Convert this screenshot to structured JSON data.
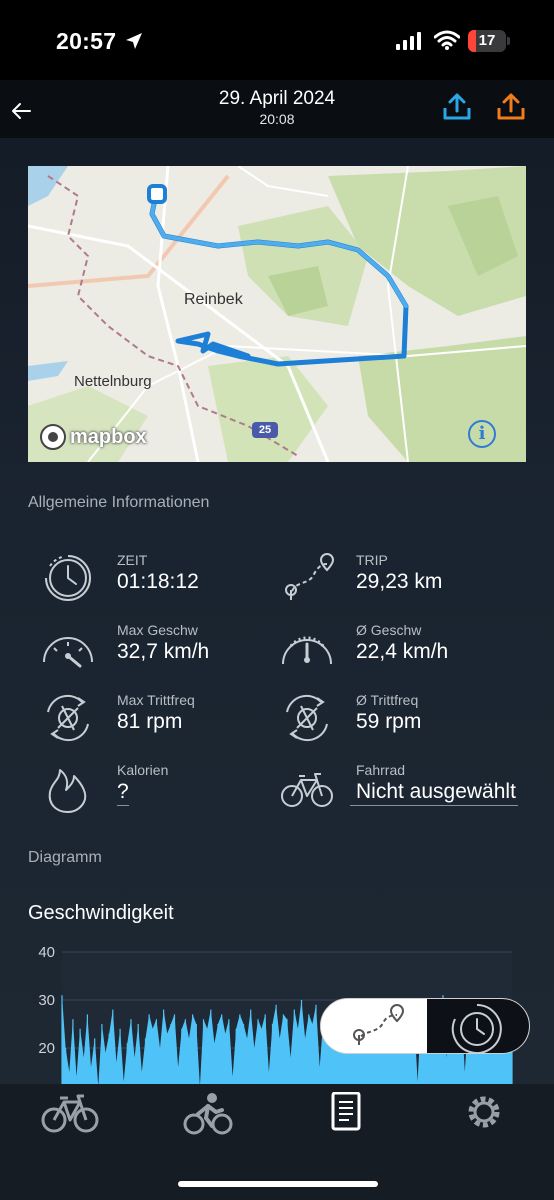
{
  "status_bar": {
    "time": "20:57",
    "battery": "17",
    "battery_level": 0.17
  },
  "header": {
    "title": "29. April 2024",
    "subtitle": "20:08"
  },
  "map": {
    "place_reinbek": "Reinbek",
    "place_nettelnburg": "Nettelnburg",
    "attribution": "mapbox",
    "road_label": "25",
    "info_symbol": "i"
  },
  "general": {
    "section_title": "Allgemeine Informationen",
    "stats": [
      {
        "icon": "clock-icon",
        "label": "ZEIT",
        "value": "01:18:12"
      },
      {
        "icon": "route-icon",
        "label": "TRIP",
        "value": "29,23 km"
      },
      {
        "icon": "speedometer-max-icon",
        "label": "Max Geschw",
        "value": "32,7 km/h"
      },
      {
        "icon": "speedometer-avg-icon",
        "label": "Ø Geschw",
        "value": "22,4 km/h"
      },
      {
        "icon": "cadence-icon",
        "label": "Max Trittfreq",
        "value": "81 rpm"
      },
      {
        "icon": "cadence-icon",
        "label": "Ø Trittfreq",
        "value": "59 rpm"
      },
      {
        "icon": "flame-icon",
        "label": "Kalorien",
        "value": "?"
      },
      {
        "icon": "bicycle-icon",
        "label": "Fahrrad",
        "value": "Nicht ausgewählt"
      }
    ]
  },
  "diagram": {
    "section_title": "Diagramm"
  },
  "chart_data": {
    "type": "area",
    "title": "Geschwindigkeit",
    "xlabel": "",
    "ylabel": "",
    "ylim": [
      10,
      40
    ],
    "yticks": [
      "40",
      "30",
      "20"
    ],
    "grid": true,
    "color": "#4fc3f7",
    "series": [
      {
        "values": [
          31,
          20,
          15,
          26,
          14,
          24,
          18,
          27,
          16,
          22,
          12,
          25,
          19,
          23,
          28,
          17,
          24,
          13,
          21,
          26,
          18,
          25,
          15,
          22,
          27,
          24,
          26,
          20,
          28,
          23,
          25,
          27,
          16,
          24,
          26,
          22,
          27,
          25,
          12,
          26,
          24,
          28,
          21,
          25,
          27,
          23,
          26,
          14,
          24,
          27,
          25,
          22,
          28,
          20,
          26,
          24,
          27,
          15,
          25,
          29,
          22,
          27,
          26,
          18,
          28,
          24,
          30,
          22,
          27,
          25,
          29,
          16,
          26,
          28,
          24,
          27,
          23,
          29,
          26,
          25,
          28,
          22,
          27,
          25,
          24,
          26,
          28,
          27,
          25,
          30,
          29,
          26,
          27,
          24,
          28,
          26,
          29,
          27,
          13,
          28,
          26,
          30,
          25,
          29,
          27,
          31,
          18,
          28,
          27,
          26,
          29,
          15,
          27,
          28,
          25,
          29,
          26,
          28,
          30,
          27,
          24,
          28,
          22,
          29,
          27
        ]
      }
    ]
  },
  "colors": {
    "accent_blue": "#2aa7e8",
    "accent_orange": "#f07d19",
    "route_blue": "#1e7fd6",
    "background": "#1a2430"
  }
}
